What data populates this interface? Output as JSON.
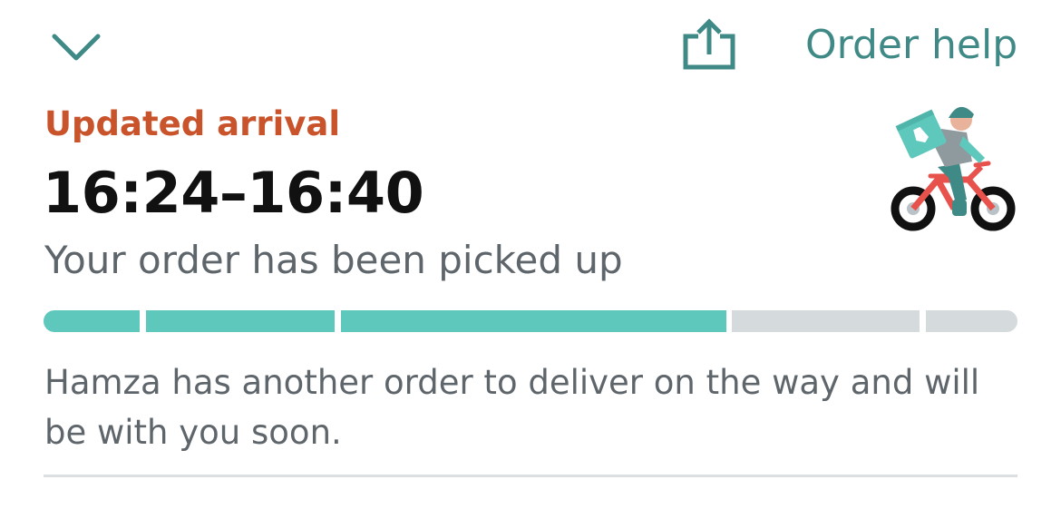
{
  "header": {
    "collapse_icon": "chevron-down-icon",
    "share_icon": "share-icon",
    "help_label": "Order help"
  },
  "arrival": {
    "label": "Updated arrival",
    "time_range": "16:24–16:40",
    "status": "Your order has been picked up"
  },
  "progress": {
    "total_steps": 5,
    "completed_steps": 3,
    "completed_fraction": 0.7
  },
  "message": "Hamza has another order to deliver on the way and will be with you soon.",
  "illustration_icon": "delivery-rider-icon",
  "colors": {
    "accent": "#3f8a86",
    "updated_label": "#c9532b",
    "progress_filled": "#5fc8bd",
    "progress_empty": "#d5dadd",
    "rider_bike": "#e8524d"
  }
}
